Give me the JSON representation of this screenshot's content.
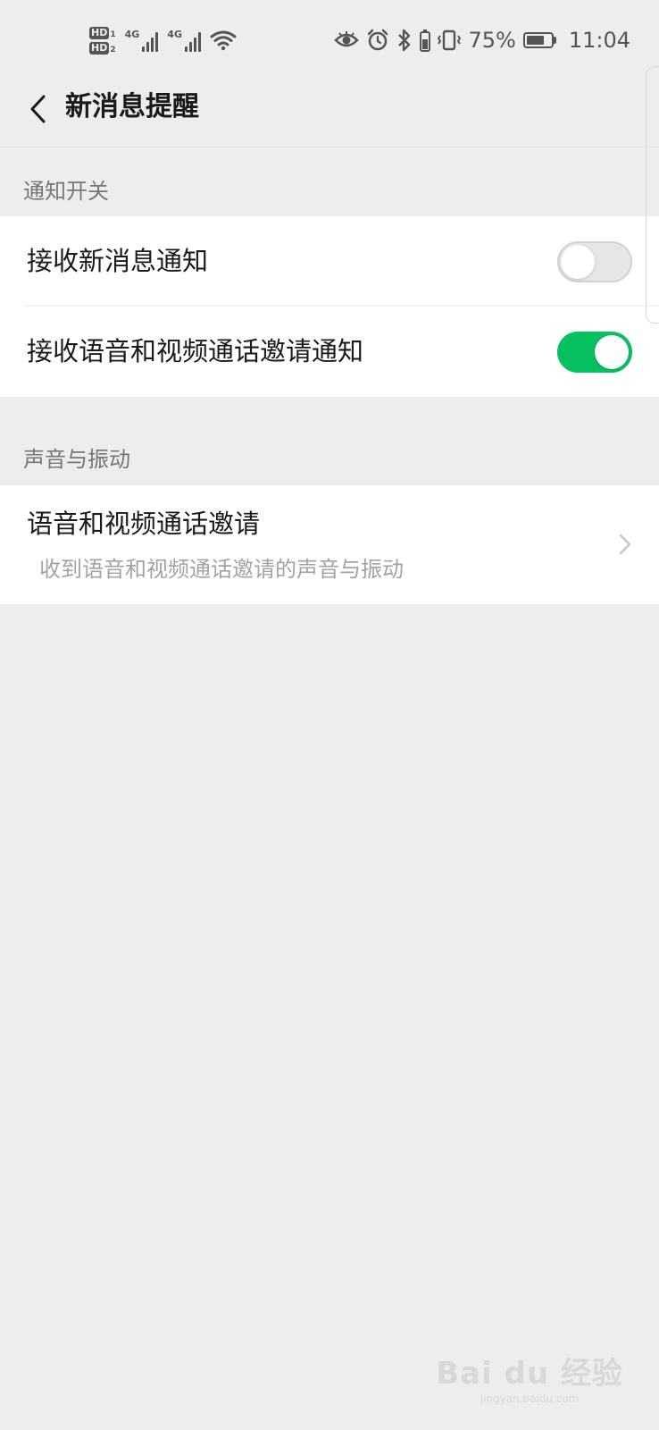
{
  "status_bar": {
    "hd1": "HD",
    "hd1_num": "1",
    "hd2": "HD",
    "hd2_num": "2",
    "net1": "4G",
    "net2": "4G",
    "battery_percent": "75%",
    "battery_level": 0.75,
    "time": "11:04",
    "icons": [
      "eye-comfort-icon",
      "alarm-icon",
      "bluetooth-icon",
      "vibrate-icon",
      "wifi-icon"
    ]
  },
  "header": {
    "title": "新消息提醒",
    "back_icon": "chevron-left-icon"
  },
  "sections": {
    "notify": {
      "label": "通知开关",
      "items": [
        {
          "label": "接收新消息通知",
          "toggle": "off"
        },
        {
          "label": "接收语音和视频通话邀请通知",
          "toggle": "on"
        }
      ]
    },
    "sound": {
      "label": "声音与振动",
      "item": {
        "label": "语音和视频通话邀请",
        "description": "收到语音和视频通话邀请的声音与振动"
      }
    }
  },
  "watermark": {
    "main": "Bai du 经验",
    "sub": "jingyan.baidu.com"
  },
  "colors": {
    "accent": "#07c160",
    "background": "#ededed",
    "card": "#ffffff"
  }
}
